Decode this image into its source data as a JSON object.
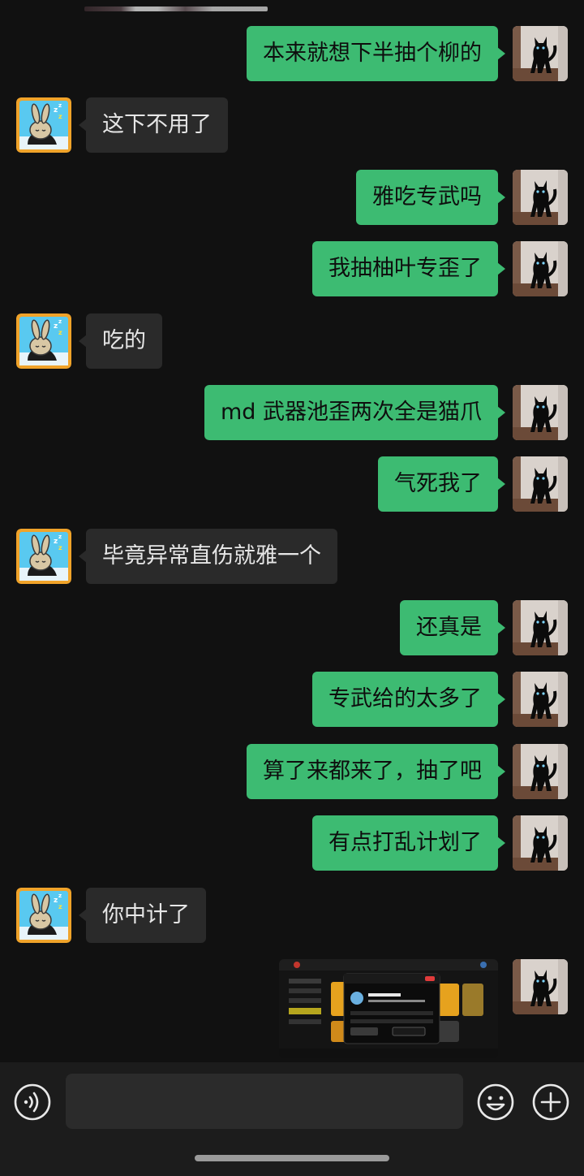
{
  "messages": [
    {
      "side": "mine",
      "text": "本来就想下半抽个柳的"
    },
    {
      "side": "theirs",
      "text": "这下不用了"
    },
    {
      "side": "mine",
      "text": "雅吃专武吗"
    },
    {
      "side": "mine",
      "text": "我抽柚叶专歪了"
    },
    {
      "side": "theirs",
      "text": "吃的"
    },
    {
      "side": "mine",
      "text": "md 武器池歪两次全是猫爪"
    },
    {
      "side": "mine",
      "text": "气死我了"
    },
    {
      "side": "theirs",
      "text": "毕竟异常直伤就雅一个"
    },
    {
      "side": "mine",
      "text": "还真是"
    },
    {
      "side": "mine",
      "text": "专武给的太多了"
    },
    {
      "side": "mine",
      "text": "算了来都来了，抽了吧"
    },
    {
      "side": "mine",
      "text": "有点打乱计划了"
    },
    {
      "side": "theirs",
      "text": "你中计了"
    }
  ],
  "image_message": {
    "side": "mine",
    "kind": "screenshot"
  },
  "input": {
    "value": "",
    "placeholder": ""
  },
  "icons": {
    "voice": "voice-icon",
    "emoji": "emoji-icon",
    "plus": "plus-icon",
    "my_avatar": "black-cat-avatar",
    "their_avatar": "sleeping-bunny-avatar"
  },
  "colors": {
    "background": "#111111",
    "my_bubble": "#3dbb72",
    "their_bubble": "#2a2a2a",
    "input_bar": "#1c1c1c"
  }
}
